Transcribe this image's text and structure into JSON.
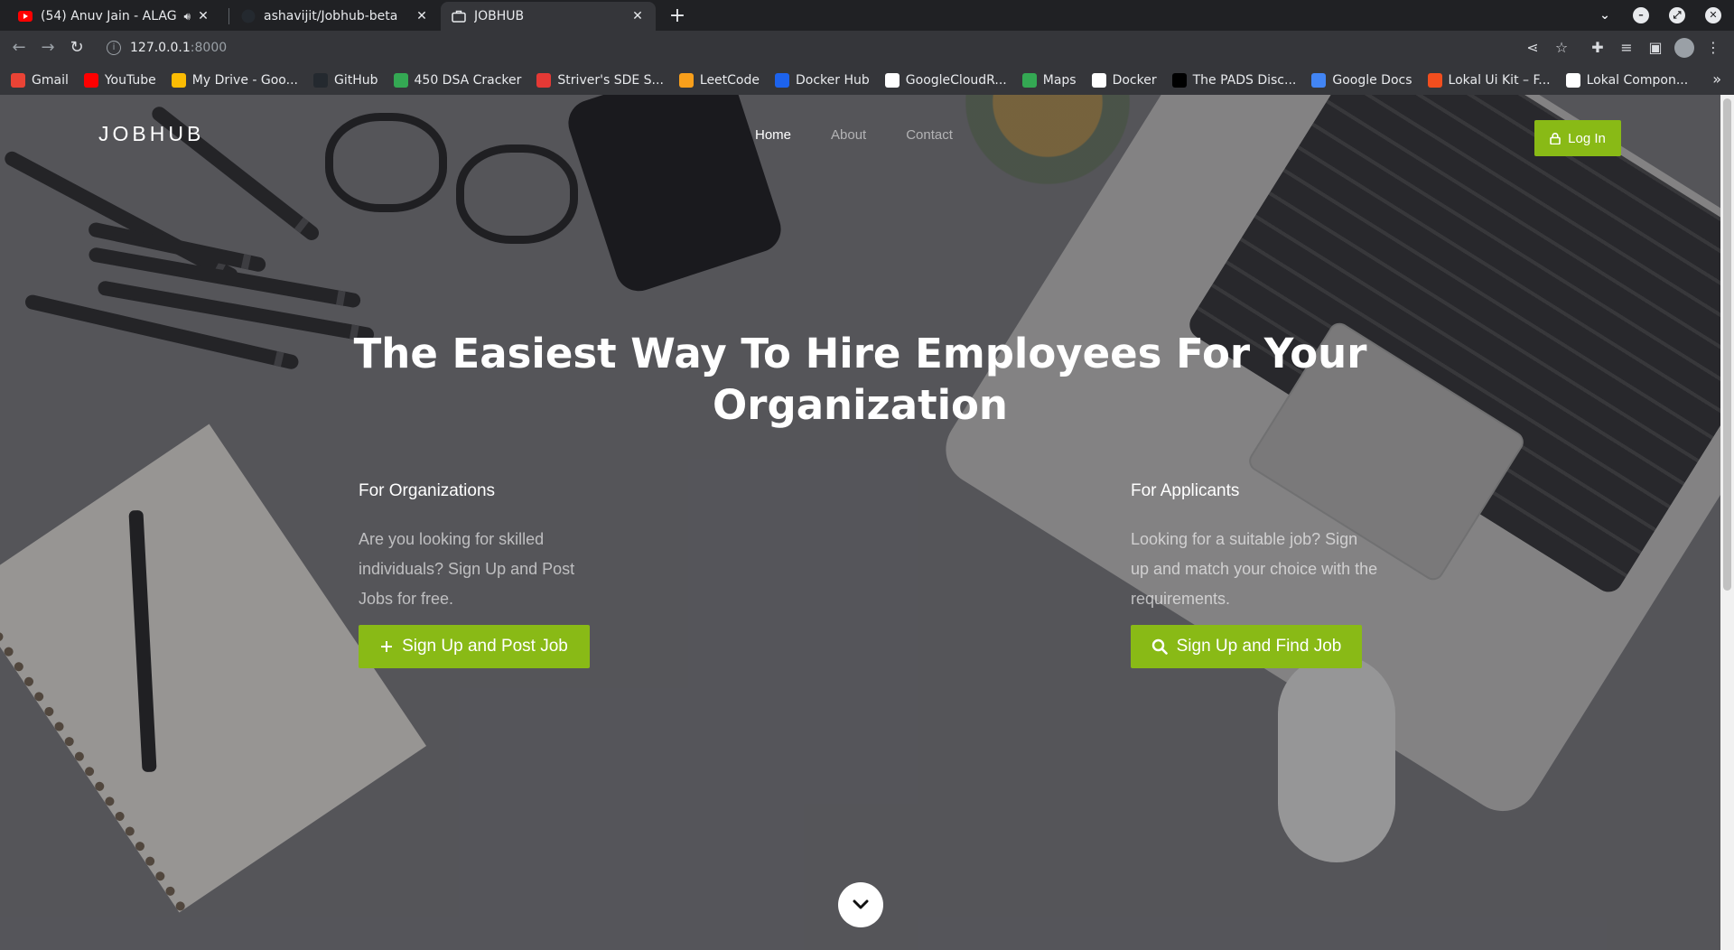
{
  "browser": {
    "tabs": [
      {
        "title": "(54) Anuv Jain - ALAG A",
        "favicon": "youtube-icon",
        "audio": true
      },
      {
        "title": "ashavijit/Jobhub-beta",
        "favicon": "github-icon"
      },
      {
        "title": "JOBHUB",
        "favicon": "briefcase-icon",
        "active": true
      }
    ],
    "url_host": "127.0.0.1",
    "url_port": ":8000",
    "bookmarks": [
      {
        "label": "Gmail",
        "icon": "gmail-icon",
        "color": "#ea4335"
      },
      {
        "label": "YouTube",
        "icon": "youtube-icon",
        "color": "#ff0000"
      },
      {
        "label": "My Drive - Goo...",
        "icon": "drive-icon",
        "color": "#fbbc04"
      },
      {
        "label": "GitHub",
        "icon": "github-icon",
        "color": "#24292f"
      },
      {
        "label": "450 DSA Cracker",
        "icon": "number-4-icon",
        "color": "#34a853"
      },
      {
        "label": "Striver's SDE S...",
        "icon": "tuf-icon",
        "color": "#e53935"
      },
      {
        "label": "LeetCode",
        "icon": "leetcode-icon",
        "color": "#f89f1b"
      },
      {
        "label": "Docker Hub",
        "icon": "docker-icon",
        "color": "#1d63ed"
      },
      {
        "label": "GoogleCloudR...",
        "icon": "google-icon",
        "color": "#ffffff"
      },
      {
        "label": "Maps",
        "icon": "maps-icon",
        "color": "#34a853"
      },
      {
        "label": "Docker",
        "icon": "globe-icon",
        "color": "#ffffff"
      },
      {
        "label": "The PADS Disc...",
        "icon": "pads-icon",
        "color": "#000000"
      },
      {
        "label": "Google Docs",
        "icon": "docs-icon",
        "color": "#4285f4"
      },
      {
        "label": "Lokal Ui Kit – F...",
        "icon": "figma-icon",
        "color": "#f24e1e"
      },
      {
        "label": "Lokal Compon...",
        "icon": "notion-icon",
        "color": "#ffffff"
      }
    ]
  },
  "site": {
    "brand": "JOBHUB",
    "nav": [
      "Home",
      "About",
      "Contact"
    ],
    "login_label": "Log In",
    "accent_color": "#89ba16"
  },
  "hero": {
    "title": "The Easiest Way To Hire Employees For Your Organization",
    "organizations": {
      "heading": "For Organizations",
      "text": "Are you looking for skilled individuals? Sign Up and Post Jobs for free.",
      "button": "Sign Up and Post Job",
      "button_icon": "plus-icon"
    },
    "applicants": {
      "heading": "For Applicants",
      "text": "Looking for a suitable job? Sign up and match your choice with the requirements.",
      "button": "Sign Up and Find Job",
      "button_icon": "search-icon"
    }
  }
}
